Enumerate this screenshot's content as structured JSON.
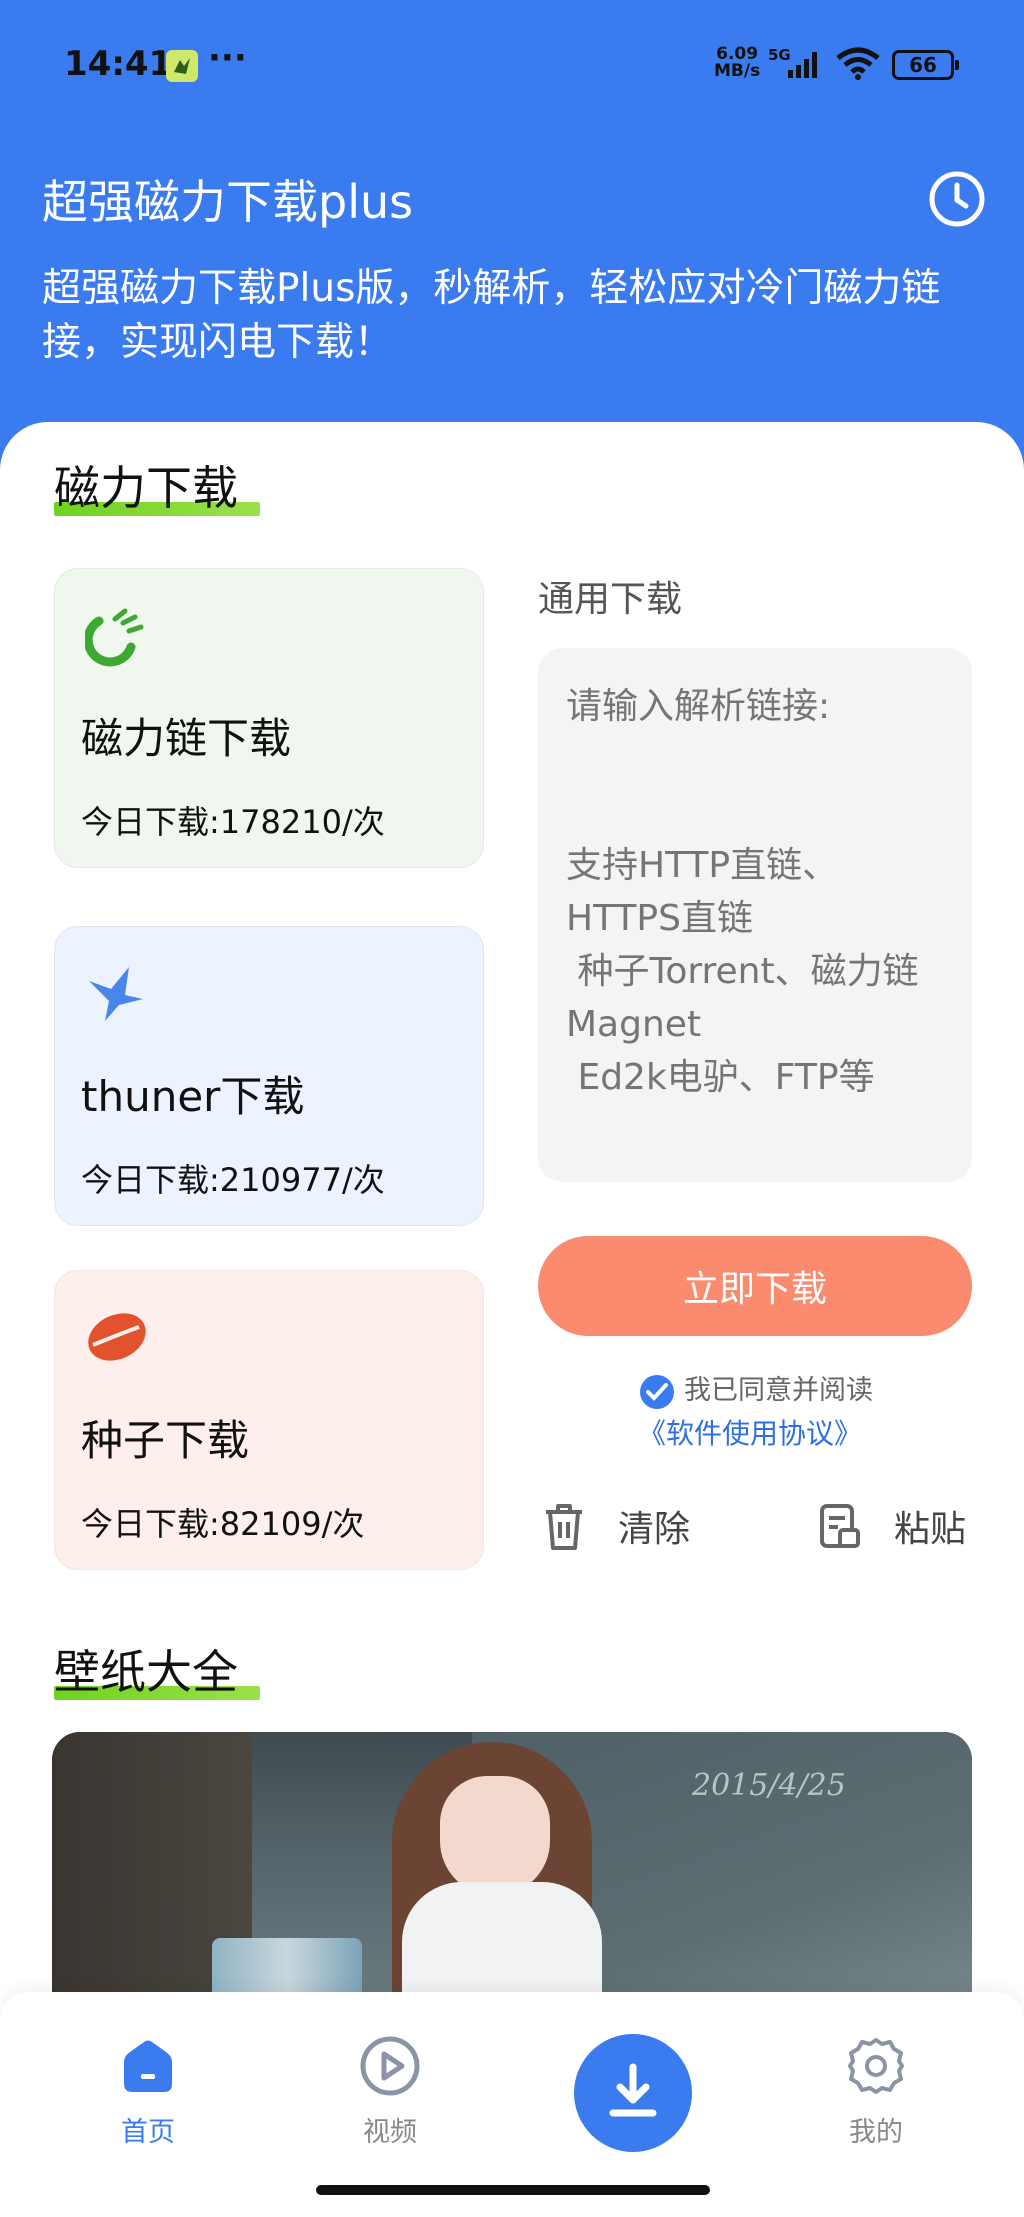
{
  "status_bar": {
    "time": "14:41",
    "more": "···",
    "speed_value": "6.09",
    "speed_unit": "MB/s",
    "network": "5G",
    "battery": "66"
  },
  "header": {
    "title": "超强磁力下载plus",
    "subtitle": "超强磁力下载Plus版，秒解析，轻松应对冷门磁力链接，实现闪电下载！"
  },
  "magnet_section": {
    "title": "磁力下载",
    "cards": [
      {
        "title": "磁力链下载",
        "count": "今日下载:178210/次",
        "icon": "magnet-icon"
      },
      {
        "title": "thuner下载",
        "count": "今日下载:210977/次",
        "icon": "bird-icon"
      },
      {
        "title": "种子下载",
        "count": "今日下载:82109/次",
        "icon": "seed-icon"
      }
    ]
  },
  "general_download": {
    "label": "通用下载",
    "placeholder": "请输入解析链接:\n\n\n支持HTTP直链、HTTPS直链\n 种子Torrent、磁力链Magnet\n Ed2k电驴、FTP等",
    "download_button": "立即下载",
    "agree_text": "我已同意并阅读",
    "agreement_link": "《软件使用协议》",
    "clear_label": "清除",
    "paste_label": "粘贴"
  },
  "wallpaper_section": {
    "title": "壁纸大全",
    "board_text": "2015/4/25"
  },
  "bottom_nav": {
    "home": "首页",
    "video": "视频",
    "mine": "我的"
  },
  "colors": {
    "primary": "#3a7bf0",
    "download_button": "#fa8b6e",
    "section_underline": "#6ed31e"
  }
}
